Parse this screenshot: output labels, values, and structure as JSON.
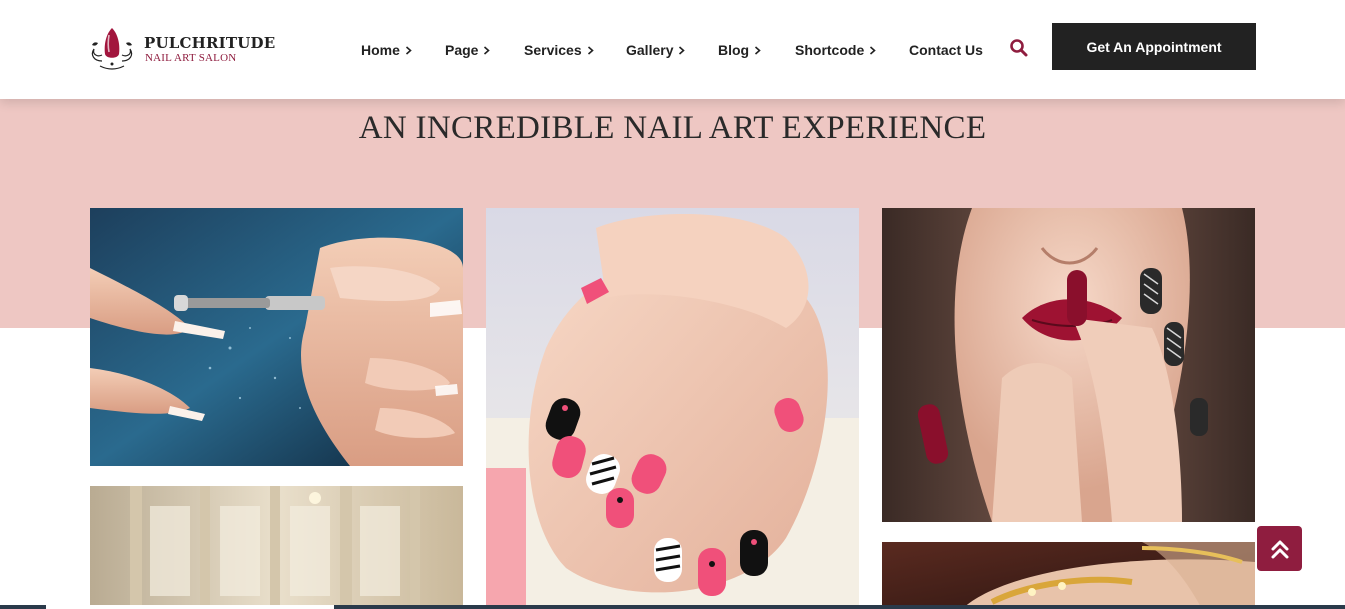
{
  "brand": {
    "title": "PULCHRITUDE",
    "subtitle": "NAIL ART SALON",
    "logo_icon": "nail-drop-logo-icon"
  },
  "nav": {
    "items": [
      {
        "label": "Home",
        "has_submenu": true
      },
      {
        "label": "Page",
        "has_submenu": true
      },
      {
        "label": "Services",
        "has_submenu": true
      },
      {
        "label": "Gallery",
        "has_submenu": true
      },
      {
        "label": "Blog",
        "has_submenu": true
      },
      {
        "label": "Shortcode",
        "has_submenu": true
      },
      {
        "label": "Contact Us",
        "has_submenu": false
      }
    ],
    "search_icon": "search-icon",
    "cta_label": "Get An Appointment"
  },
  "hero": {
    "headline": "AN INCREDIBLE NAIL ART EXPERIENCE"
  },
  "gallery": {
    "images": [
      "nail-filing-drill-photo",
      "pink-black-zebra-nails-photo",
      "red-lips-nails-photo",
      "salon-interior-photo",
      "gold-jewelry-hand-photo"
    ]
  },
  "scroll_top_icon": "double-chevron-up-icon",
  "colors": {
    "accent": "#8f1d3f",
    "band": "#eec7c3",
    "dark": "#222222"
  }
}
